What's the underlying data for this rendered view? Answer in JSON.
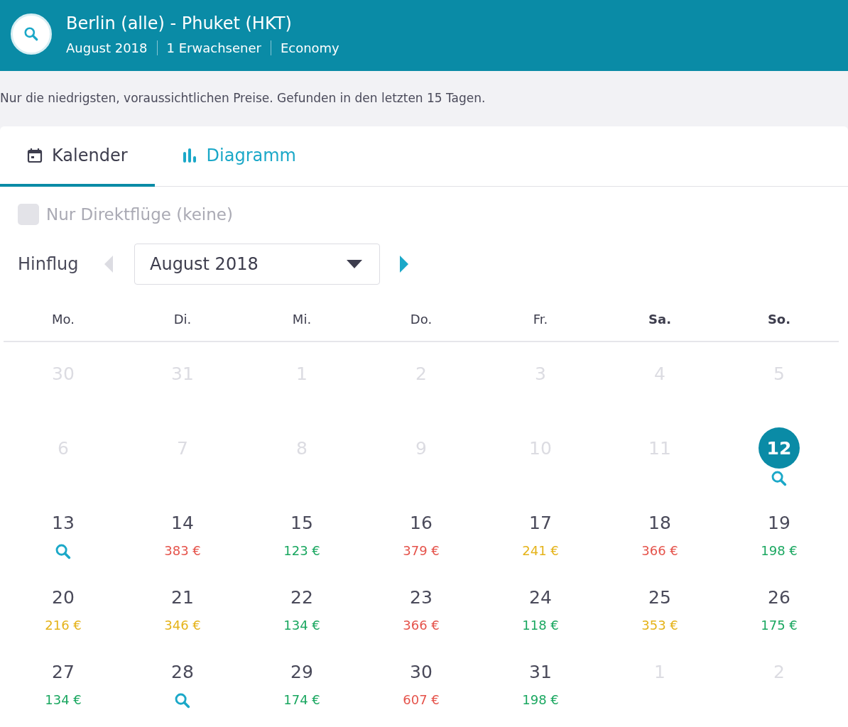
{
  "header": {
    "title": "Berlin (alle) - Phuket (HKT)",
    "details": [
      "August 2018",
      "1 Erwachsener",
      "Economy"
    ]
  },
  "info": "Nur die niedrigsten, voraussichtlichen Preise. Gefunden in den letzten 15 Tagen.",
  "tabs": [
    {
      "label": "Kalender",
      "selected": true
    },
    {
      "label": "Diagramm",
      "selected": false
    }
  ],
  "direct_only": {
    "label": "Nur Direktflüge (keine)",
    "checked": false,
    "disabled": true
  },
  "month_nav": {
    "label": "Hinflug",
    "month": "August 2018",
    "prev_disabled": true,
    "next_disabled": false
  },
  "weekdays": [
    {
      "label": "Mo.",
      "weekend": false
    },
    {
      "label": "Di.",
      "weekend": false
    },
    {
      "label": "Mi.",
      "weekend": false
    },
    {
      "label": "Do.",
      "weekend": false
    },
    {
      "label": "Fr.",
      "weekend": false
    },
    {
      "label": "Sa.",
      "weekend": true
    },
    {
      "label": "So.",
      "weekend": true
    }
  ],
  "weeks": [
    [
      {
        "day": "30",
        "kind": "inactive"
      },
      {
        "day": "31",
        "kind": "inactive"
      },
      {
        "day": "1",
        "kind": "inactive"
      },
      {
        "day": "2",
        "kind": "inactive"
      },
      {
        "day": "3",
        "kind": "inactive"
      },
      {
        "day": "4",
        "kind": "inactive"
      },
      {
        "day": "5",
        "kind": "inactive"
      }
    ],
    [
      {
        "day": "6",
        "kind": "inactive"
      },
      {
        "day": "7",
        "kind": "inactive"
      },
      {
        "day": "8",
        "kind": "inactive"
      },
      {
        "day": "9",
        "kind": "inactive"
      },
      {
        "day": "10",
        "kind": "inactive"
      },
      {
        "day": "11",
        "kind": "inactive"
      },
      {
        "day": "12",
        "kind": "search",
        "selected": true
      }
    ],
    [
      {
        "day": "13",
        "kind": "search",
        "selected": false
      },
      {
        "day": "14",
        "kind": "price",
        "price": "383 €",
        "color": "#e5534b"
      },
      {
        "day": "15",
        "kind": "price",
        "price": "123 €",
        "color": "#1aa760"
      },
      {
        "day": "16",
        "kind": "price",
        "price": "379 €",
        "color": "#e5534b"
      },
      {
        "day": "17",
        "kind": "price",
        "price": "241 €",
        "color": "#e5b31a"
      },
      {
        "day": "18",
        "kind": "price",
        "price": "366 €",
        "color": "#e5534b"
      },
      {
        "day": "19",
        "kind": "price",
        "price": "198 €",
        "color": "#1aa760"
      }
    ],
    [
      {
        "day": "20",
        "kind": "price",
        "price": "216 €",
        "color": "#e5b31a"
      },
      {
        "day": "21",
        "kind": "price",
        "price": "346 €",
        "color": "#e5b31a"
      },
      {
        "day": "22",
        "kind": "price",
        "price": "134 €",
        "color": "#1aa760"
      },
      {
        "day": "23",
        "kind": "price",
        "price": "366 €",
        "color": "#e5534b"
      },
      {
        "day": "24",
        "kind": "price",
        "price": "118 €",
        "color": "#1aa760"
      },
      {
        "day": "25",
        "kind": "price",
        "price": "353 €",
        "color": "#e5b31a"
      },
      {
        "day": "26",
        "kind": "price",
        "price": "175 €",
        "color": "#1aa760"
      }
    ],
    [
      {
        "day": "27",
        "kind": "price",
        "price": "134 €",
        "color": "#1aa760"
      },
      {
        "day": "28",
        "kind": "search",
        "selected": false
      },
      {
        "day": "29",
        "kind": "price",
        "price": "174 €",
        "color": "#1aa760"
      },
      {
        "day": "30",
        "kind": "price",
        "price": "607 €",
        "color": "#e5534b"
      },
      {
        "day": "31",
        "kind": "price",
        "price": "198 €",
        "color": "#1aa760"
      },
      {
        "day": "1",
        "kind": "inactive"
      },
      {
        "day": "2",
        "kind": "inactive"
      }
    ]
  ]
}
